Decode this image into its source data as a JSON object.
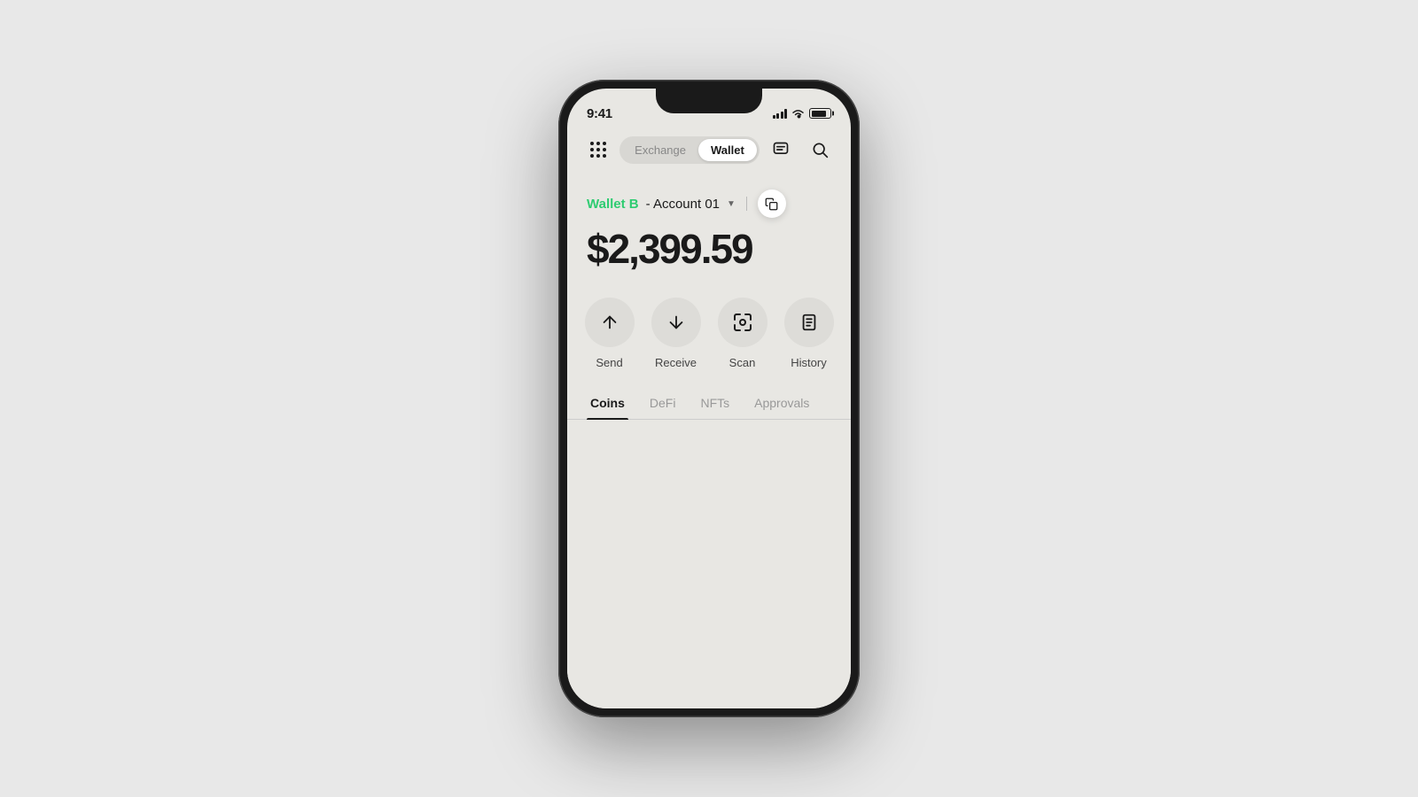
{
  "status": {
    "time": "9:41",
    "battery_level": "80"
  },
  "header": {
    "exchange_label": "Exchange",
    "wallet_label": "Wallet",
    "active_tab": "wallet"
  },
  "account": {
    "wallet_name": "Wallet B",
    "account_name": "- Account 01",
    "balance": "$2,399.59"
  },
  "actions": [
    {
      "id": "send",
      "label": "Send"
    },
    {
      "id": "receive",
      "label": "Receive"
    },
    {
      "id": "scan",
      "label": "Scan"
    },
    {
      "id": "history",
      "label": "History"
    }
  ],
  "tabs": [
    {
      "id": "coins",
      "label": "Coins",
      "active": true
    },
    {
      "id": "defi",
      "label": "DeFi",
      "active": false
    },
    {
      "id": "nfts",
      "label": "NFTs",
      "active": false
    },
    {
      "id": "approvals",
      "label": "Approvals",
      "active": false
    }
  ]
}
